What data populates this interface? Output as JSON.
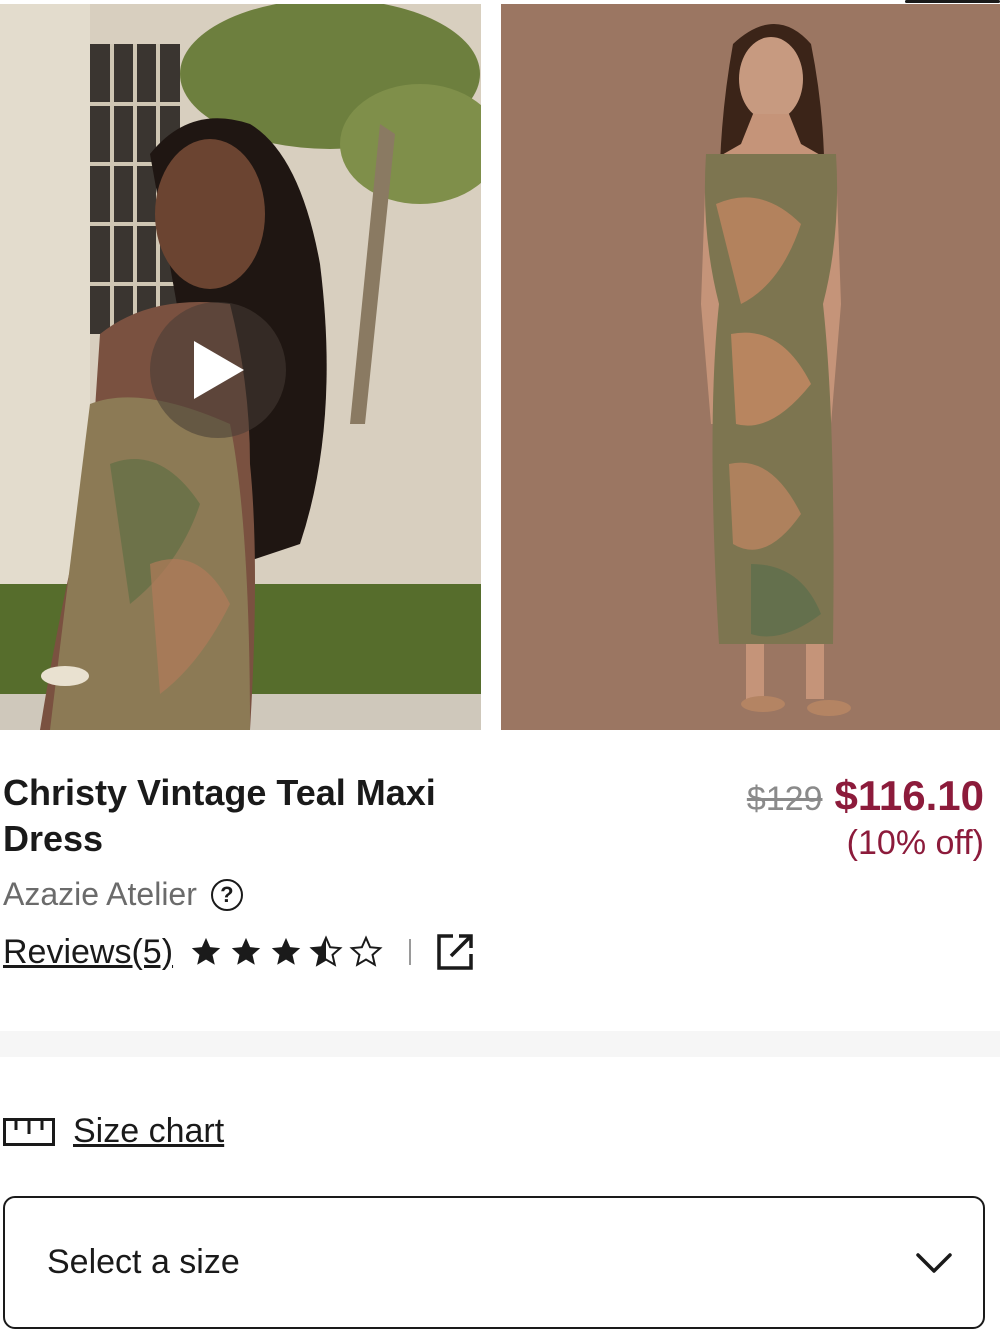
{
  "product": {
    "title": "Christy Vintage Teal Maxi Dress",
    "brand": "Azazie Atelier",
    "original_price": "$129",
    "sale_price": "$116.10",
    "discount": "(10% off)",
    "reviews_label": "Reviews(5)",
    "rating": 3.5,
    "rating_max": 5
  },
  "gallery": {
    "images": [
      {
        "icon": "product-video-thumbnail"
      },
      {
        "icon": "product-photo"
      }
    ],
    "play_icon": "play-icon"
  },
  "size": {
    "chart_label": "Size chart",
    "select_label": "Select a size"
  },
  "colors": {
    "accent": "#8c1b3b",
    "text": "#1a1a1a",
    "muted": "#6b6b6b",
    "strike": "#8a8a8a"
  }
}
